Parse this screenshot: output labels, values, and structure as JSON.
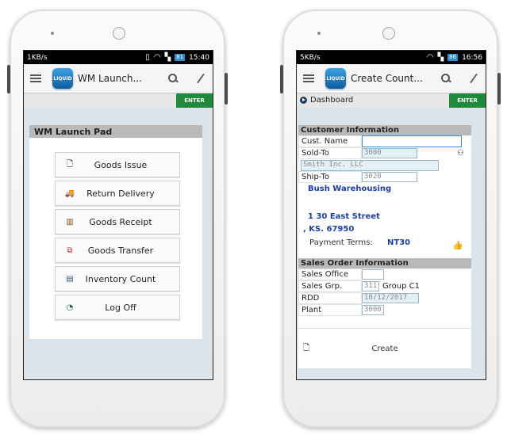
{
  "left_phone": {
    "status": {
      "speed": "1KB/s",
      "battery": "81",
      "time": "15:40"
    },
    "app_title": "WM Launch...",
    "logo_text": "LIQUID",
    "enter_label": "ENTER",
    "panel_title": "WM Launch Pad",
    "menu": [
      {
        "icon": "document-icon",
        "glyph": "🗋",
        "label": "Goods Issue"
      },
      {
        "icon": "truck-icon",
        "glyph": "🚚",
        "label": "Return Delivery"
      },
      {
        "icon": "receipt-icon",
        "glyph": "▥",
        "label": "Goods Receipt"
      },
      {
        "icon": "transfer-icon",
        "glyph": "⧉",
        "label": "Goods Transfer"
      },
      {
        "icon": "clipboard-icon",
        "glyph": "▤",
        "label": "Inventory Count"
      },
      {
        "icon": "logoff-icon",
        "glyph": "◔",
        "label": "Log Off"
      }
    ]
  },
  "right_phone": {
    "status": {
      "speed": "5KB/s",
      "battery": "86",
      "time": "16:56"
    },
    "app_title": "Create Count...",
    "logo_text": "LIQUID",
    "enter_label": "ENTER",
    "dashboard_label": "Dashboard",
    "customer_section": {
      "title": "Customer Information",
      "cust_name_label": "Cust. Name",
      "cust_name_value": "",
      "sold_to_label": "Sold-To",
      "sold_to_value": "3000",
      "sold_to_name": "Smith Inc. LLC",
      "ship_to_label": "Ship-To",
      "ship_to_value": "3020",
      "ship_to_name": "Bush Warehousing",
      "address_line1": "1 30 East Street",
      "address_line2": ", KS. 67950",
      "payment_terms_label": "Payment Terms:",
      "payment_terms_value": "NT30"
    },
    "sales_section": {
      "title": "Sales Order Information",
      "office_label": "Sales Office",
      "office_value": "",
      "group_label": "Sales Grp.",
      "group_value": "311",
      "group_name": "Group C1",
      "rdd_label": "RDD",
      "rdd_value": "10/12/2017",
      "plant_label": "Plant",
      "plant_value": "3000"
    },
    "create_label": "Create"
  },
  "colors": {
    "enter_green": "#1f8a3b",
    "header_gray": "#b9b9b9",
    "link_blue": "#1c3fa3"
  }
}
